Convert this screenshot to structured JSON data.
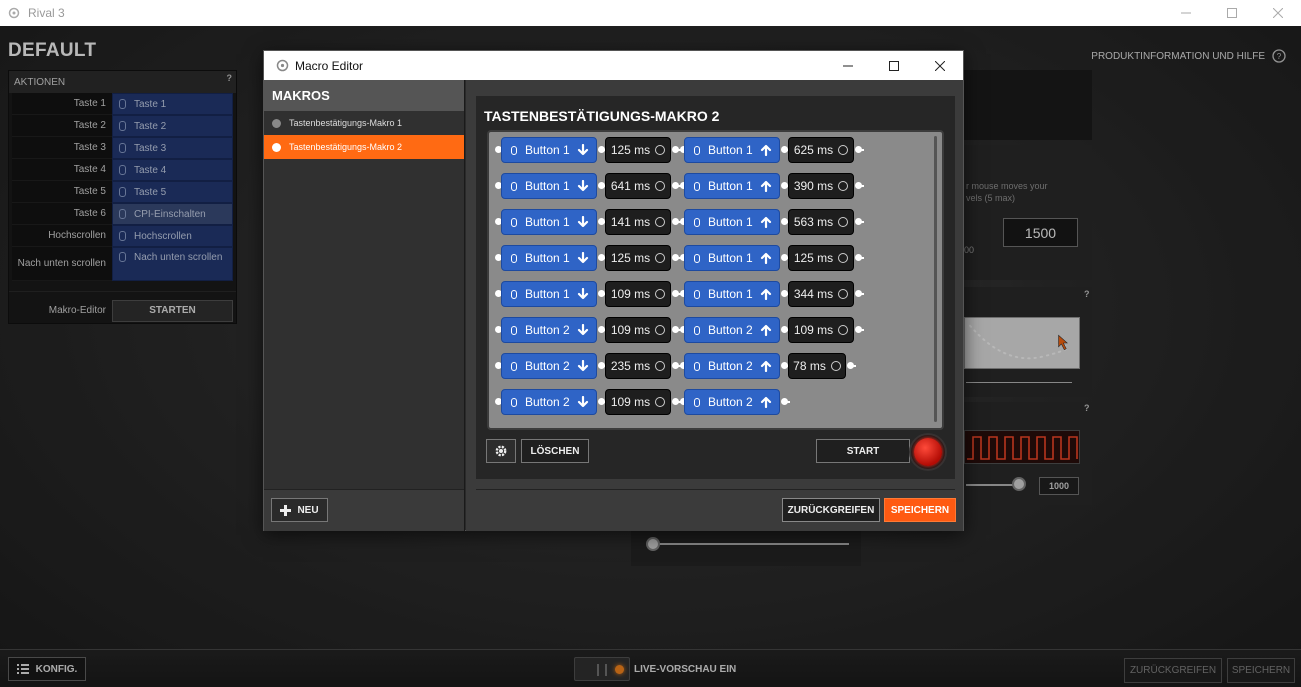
{
  "window": {
    "title": "Rival 3",
    "controls": [
      "minimize",
      "maximize",
      "close"
    ]
  },
  "profile": {
    "name": "DEFAULT"
  },
  "help_link": "PRODUKTINFORMATION UND HILFE",
  "actions": {
    "header": "AKTIONEN",
    "help": "?",
    "rows": [
      {
        "label": "Taste 1",
        "value": "Taste 1"
      },
      {
        "label": "Taste 2",
        "value": "Taste 2"
      },
      {
        "label": "Taste 3",
        "value": "Taste 3"
      },
      {
        "label": "Taste 4",
        "value": "Taste 4"
      },
      {
        "label": "Taste 5",
        "value": "Taste 5"
      },
      {
        "label": "Taste 6",
        "value": "CPI-Einschalten"
      },
      {
        "label": "Hochscrollen",
        "value": "Hochscrollen"
      },
      {
        "label": "Nach unten scrollen",
        "value": "Nach unten scrollen"
      }
    ],
    "macro_editor_label": "Makro-Editor",
    "macro_editor_button": "STARTEN"
  },
  "background_right": {
    "cpi_hint": "r mouse moves your",
    "cpi_hint2": "vels (5 max)",
    "cpi_value": "1500",
    "cpi_small": "00",
    "poll_value": "1000",
    "help": "?"
  },
  "bottom": {
    "config_button": "KONFIG.",
    "live_preview": "LIVE-VORSCHAU EIN",
    "undo_button": "ZURÜCKGREIFEN",
    "save_button": "SPEICHERN"
  },
  "macro_editor": {
    "window_title": "Macro Editor",
    "list_header": "MAKROS",
    "macros": [
      {
        "name": "Tastenbestätigungs-Makro 1",
        "active": false
      },
      {
        "name": "Tastenbestätigungs-Makro 2",
        "active": true
      }
    ],
    "new_button": "NEU",
    "editor_title": "TASTENBESTÄTIGUNGS-MAKRO 2",
    "sequence": [
      [
        {
          "type": "button",
          "label": "Button 1",
          "dir": "down"
        },
        {
          "type": "delay",
          "label": "125 ms"
        },
        {
          "type": "button",
          "label": "Button 1",
          "dir": "up"
        },
        {
          "type": "delay",
          "label": "625 ms"
        }
      ],
      [
        {
          "type": "button",
          "label": "Button 1",
          "dir": "down"
        },
        {
          "type": "delay",
          "label": "641 ms"
        },
        {
          "type": "button",
          "label": "Button 1",
          "dir": "up"
        },
        {
          "type": "delay",
          "label": "390 ms"
        }
      ],
      [
        {
          "type": "button",
          "label": "Button 1",
          "dir": "down"
        },
        {
          "type": "delay",
          "label": "141 ms"
        },
        {
          "type": "button",
          "label": "Button 1",
          "dir": "up"
        },
        {
          "type": "delay",
          "label": "563 ms"
        }
      ],
      [
        {
          "type": "button",
          "label": "Button 1",
          "dir": "down"
        },
        {
          "type": "delay",
          "label": "125 ms"
        },
        {
          "type": "button",
          "label": "Button 1",
          "dir": "up"
        },
        {
          "type": "delay",
          "label": "125 ms"
        }
      ],
      [
        {
          "type": "button",
          "label": "Button 1",
          "dir": "down"
        },
        {
          "type": "delay",
          "label": "109 ms"
        },
        {
          "type": "button",
          "label": "Button 1",
          "dir": "up"
        },
        {
          "type": "delay",
          "label": "344 ms"
        }
      ],
      [
        {
          "type": "button",
          "label": "Button 2",
          "dir": "down"
        },
        {
          "type": "delay",
          "label": "109 ms"
        },
        {
          "type": "button",
          "label": "Button 2",
          "dir": "up"
        },
        {
          "type": "delay",
          "label": "109 ms"
        }
      ],
      [
        {
          "type": "button",
          "label": "Button 2",
          "dir": "down"
        },
        {
          "type": "delay",
          "label": "235 ms"
        },
        {
          "type": "button",
          "label": "Button 2",
          "dir": "up"
        },
        {
          "type": "delay",
          "label": "78 ms"
        }
      ],
      [
        {
          "type": "button",
          "label": "Button 2",
          "dir": "down"
        },
        {
          "type": "delay",
          "label": "109 ms"
        },
        {
          "type": "button",
          "label": "Button 2",
          "dir": "up"
        }
      ]
    ],
    "delete_button": "LÖSCHEN",
    "start_button": "START",
    "undo_button": "ZURÜCKGREIFEN",
    "save_button": "SPEICHERN",
    "colors": {
      "accent": "#ff6a13",
      "button_block": "#2f64c6",
      "record": "#d8140b"
    }
  }
}
